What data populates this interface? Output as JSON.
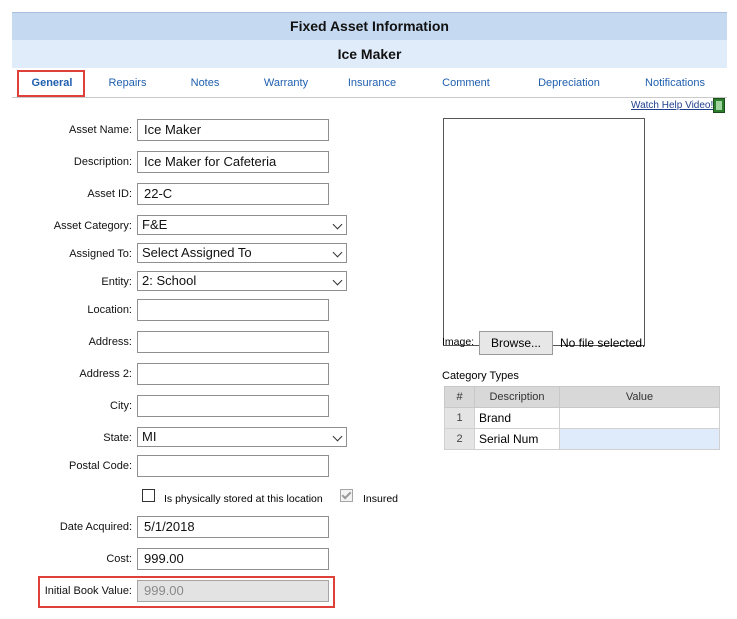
{
  "header": {
    "title": "Fixed Asset Information",
    "subtitle": "Ice Maker"
  },
  "tabs": [
    "General",
    "Repairs",
    "Notes",
    "Warranty",
    "Insurance",
    "Comment",
    "Depreciation",
    "Notifications"
  ],
  "help_link": "Watch Help Video!",
  "form": {
    "asset_name": {
      "label": "Asset Name:",
      "value": "Ice Maker"
    },
    "description": {
      "label": "Description:",
      "value": "Ice Maker for Cafeteria"
    },
    "asset_id": {
      "label": "Asset ID:",
      "value": "22-C"
    },
    "asset_category": {
      "label": "Asset Category:",
      "value": "F&E"
    },
    "assigned_to": {
      "label": "Assigned To:",
      "value": "Select Assigned To"
    },
    "entity": {
      "label": "Entity:",
      "value": "2: School"
    },
    "location": {
      "label": "Location:",
      "value": ""
    },
    "address": {
      "label": "Address:",
      "value": ""
    },
    "address2": {
      "label": "Address 2:",
      "value": ""
    },
    "city": {
      "label": "City:",
      "value": ""
    },
    "state": {
      "label": "State:",
      "value": "MI"
    },
    "postal_code": {
      "label": "Postal Code:",
      "value": ""
    },
    "physically_stored": {
      "label": "Is physically stored at this location",
      "checked": false
    },
    "insured": {
      "label": "Insured",
      "checked": true
    },
    "date_acquired": {
      "label": "Date Acquired:",
      "value": "5/1/2018"
    },
    "cost": {
      "label": "Cost:",
      "value": "999.00"
    },
    "initial_book_value": {
      "label": "Initial Book Value:",
      "value": "999.00"
    }
  },
  "image": {
    "label": "Image:",
    "browse_label": "Browse...",
    "file_status": "No file selected."
  },
  "category_types": {
    "title": "Category Types",
    "columns": [
      "#",
      "Description",
      "Value"
    ],
    "rows": [
      {
        "num": "1",
        "description": "Brand",
        "value": ""
      },
      {
        "num": "2",
        "description": "Serial Num",
        "value": ""
      }
    ]
  }
}
